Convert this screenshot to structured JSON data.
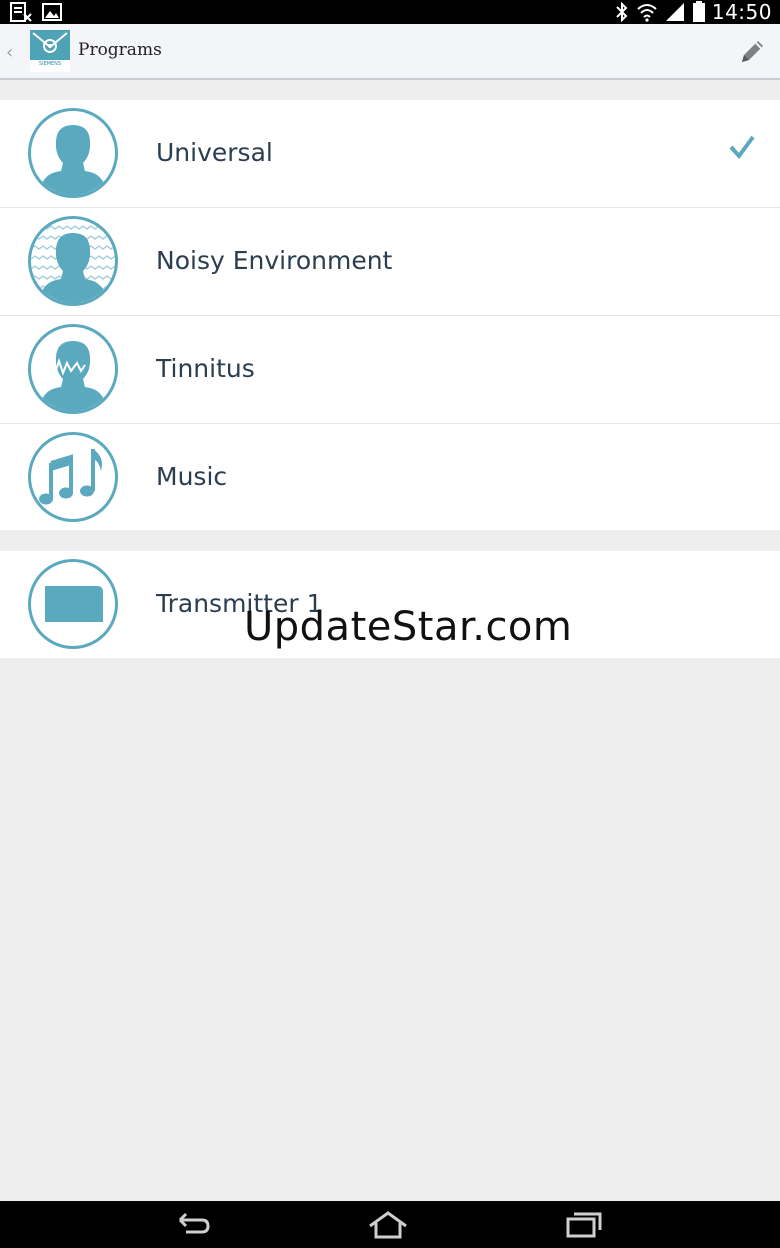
{
  "status_bar": {
    "time": "14:50",
    "left_icons": [
      "sim-card-icon",
      "image-icon"
    ],
    "right_icons": [
      "bluetooth-icon",
      "wifi-icon",
      "signal-icon",
      "battery-icon"
    ]
  },
  "action_bar": {
    "title": "Programs",
    "logo_text": "SIEMENS",
    "back_icon": "chevron-left-icon",
    "edit_icon": "pencil-icon"
  },
  "programs": [
    {
      "label": "Universal",
      "icon": "person-icon",
      "selected": true
    },
    {
      "label": "Noisy Environment",
      "icon": "person-noise-icon",
      "selected": false
    },
    {
      "label": "Tinnitus",
      "icon": "person-tinnitus-icon",
      "selected": false
    },
    {
      "label": "Music",
      "icon": "music-notes-icon",
      "selected": false
    }
  ],
  "transmitters": [
    {
      "label": "Transmitter 1",
      "icon": "transmitter-icon"
    }
  ],
  "watermark": "UpdateStar.com",
  "nav_bar": {
    "buttons": [
      "back-icon",
      "home-icon",
      "recent-apps-icon"
    ]
  },
  "colors": {
    "accent": "#5aa9bf",
    "text": "#2b3e50",
    "background": "#eeeeee"
  }
}
